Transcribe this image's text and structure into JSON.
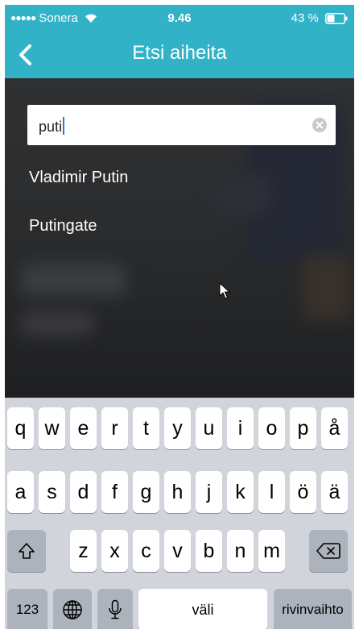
{
  "status_bar": {
    "carrier": "Sonera",
    "time": "9.46",
    "battery": "43 %"
  },
  "nav": {
    "title": "Etsi aiheita"
  },
  "search": {
    "value": "puti"
  },
  "results": [
    "Vladimir Putin",
    "Putingate"
  ],
  "keyboard": {
    "row1": [
      "q",
      "w",
      "e",
      "r",
      "t",
      "y",
      "u",
      "i",
      "o",
      "p",
      "å"
    ],
    "row2": [
      "a",
      "s",
      "d",
      "f",
      "g",
      "h",
      "j",
      "k",
      "l",
      "ö",
      "ä"
    ],
    "row3": [
      "z",
      "x",
      "c",
      "v",
      "b",
      "n",
      "m"
    ],
    "numbers_label": "123",
    "space_label": "väli",
    "return_label": "rivinvaihto"
  },
  "colors": {
    "header": "#32b2c7",
    "keyboard_bg": "#d1d5db",
    "function_key": "#adb3bc"
  }
}
